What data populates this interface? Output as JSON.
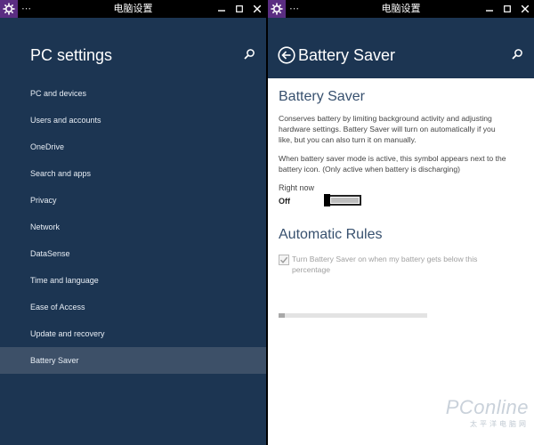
{
  "left_window": {
    "titlebar": {
      "title": "电脑设置",
      "menu_glyph": "⋯",
      "min_glyph": "▬",
      "max_glyph": "▢",
      "close_glyph": "✕"
    },
    "header": {
      "title": "PC settings",
      "search_icon": "search-icon"
    },
    "nav": [
      {
        "label": "PC and devices"
      },
      {
        "label": "Users and accounts"
      },
      {
        "label": "OneDrive"
      },
      {
        "label": "Search and apps"
      },
      {
        "label": "Privacy"
      },
      {
        "label": "Network"
      },
      {
        "label": "DataSense"
      },
      {
        "label": "Time and language"
      },
      {
        "label": "Ease of Access"
      },
      {
        "label": "Update and recovery"
      },
      {
        "label": "Battery Saver",
        "selected": true
      }
    ]
  },
  "right_window": {
    "titlebar": {
      "title": "电脑设置",
      "menu_glyph": "⋯",
      "min_glyph": "▬",
      "max_glyph": "▢",
      "close_glyph": "✕"
    },
    "header": {
      "title": "Battery Saver",
      "back_icon": "back-arrow-icon",
      "search_icon": "search-icon"
    },
    "content": {
      "section_title": "Battery Saver",
      "description": "Conserves battery by limiting background activity and adjusting hardware settings. Battery Saver will turn on automatically if you like, but you can also turn it on manually.",
      "symbol_note": "When battery saver mode is active, this symbol appears next to the battery icon. (Only active when battery is discharging)",
      "right_now_label": "Right now",
      "toggle_state": "Off",
      "toggle_on": false,
      "rules_title": "Automatic Rules",
      "checkbox_label": "Turn Battery Saver on when my battery gets below this percentage",
      "checkbox_checked": true,
      "slider_value_fraction": 0.04
    },
    "watermark": {
      "main": "PConline",
      "sub": "太平洋电脑网"
    }
  },
  "colors": {
    "panel_bg": "#1c3552",
    "selected_bg": "#3d5068",
    "titlebar_bg": "#000000",
    "app_icon_bg": "#5a2d82",
    "heading_blue": "#37506e"
  }
}
